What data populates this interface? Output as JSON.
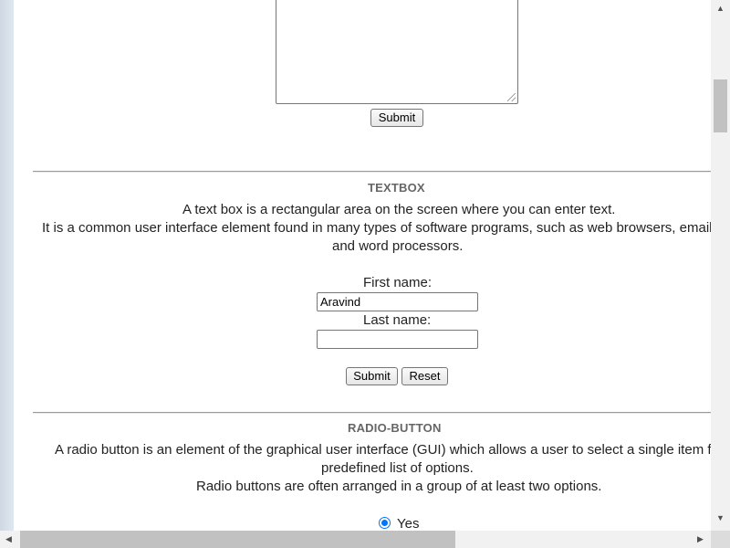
{
  "textarea_section": {
    "submit_label": "Submit"
  },
  "textbox_section": {
    "title": "TEXTBOX",
    "description_line1": "A text box is a rectangular area on the screen where you can enter text.",
    "description_line2": "It is a common user interface element found in many types of software programs, such as web browsers, email c",
    "description_line3": "and word processors.",
    "first_name_label": "First name:",
    "first_name_value": "Aravind",
    "last_name_label": "Last name:",
    "last_name_value": "",
    "submit_label": "Submit",
    "reset_label": "Reset"
  },
  "radio_section": {
    "title": "RADIO-BUTTON",
    "description_line1": "A radio button is an element of the graphical user interface (GUI) which allows a user to select a single item fro",
    "description_line2": "predefined list of options.",
    "description_line3": "Radio buttons are often arranged in a group of at least two options.",
    "options": [
      {
        "label": "Yes",
        "selected": true
      }
    ]
  },
  "scrollbars": {
    "vertical_position": 0.15,
    "horizontal_position": 0.0
  }
}
